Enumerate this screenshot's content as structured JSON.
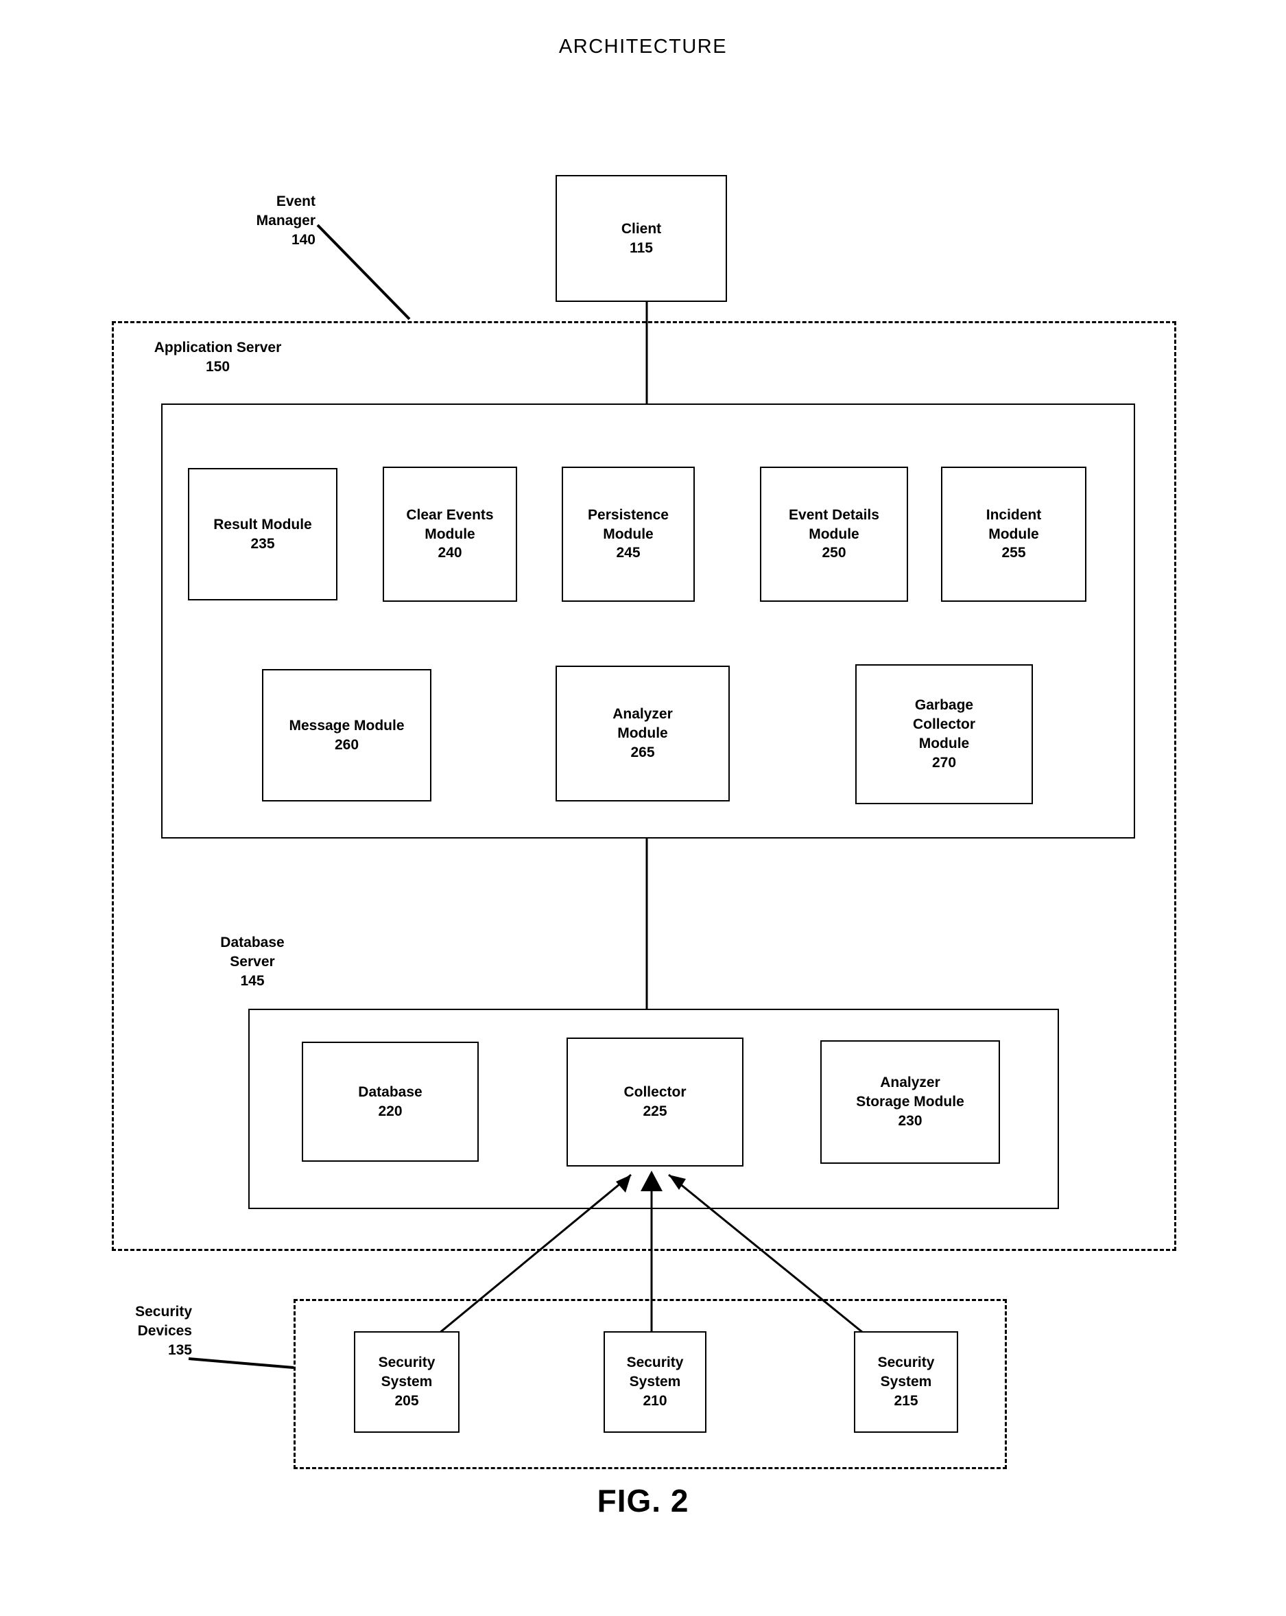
{
  "page": {
    "title": "ARCHITECTURE",
    "figure_caption": "FIG. 2"
  },
  "labels": {
    "event_manager": "Event\nManager\n140",
    "application_server": "Application Server\n150",
    "database_server": "Database\nServer\n145",
    "security_devices": "Security\nDevices\n135"
  },
  "nodes": {
    "client": {
      "title": "Client",
      "number": "115"
    },
    "result_module": {
      "title": "Result Module",
      "number": "235"
    },
    "clear_events": {
      "title": "Clear Events\nModule",
      "number": "240"
    },
    "persistence": {
      "title": "Persistence\nModule",
      "number": "245"
    },
    "event_details": {
      "title": "Event Details\nModule",
      "number": "250"
    },
    "incident": {
      "title": "Incident\nModule",
      "number": "255"
    },
    "message_module": {
      "title": "Message Module",
      "number": "260"
    },
    "analyzer_module": {
      "title": "Analyzer\nModule",
      "number": "265"
    },
    "garbage_collector": {
      "title": "Garbage\nCollector\nModule",
      "number": "270"
    },
    "database": {
      "title": "Database",
      "number": "220"
    },
    "collector": {
      "title": "Collector",
      "number": "225"
    },
    "analyzer_storage": {
      "title": "Analyzer\nStorage Module",
      "number": "230"
    },
    "security_system_205": {
      "title": "Security\nSystem",
      "number": "205"
    },
    "security_system_210": {
      "title": "Security\nSystem",
      "number": "210"
    },
    "security_system_215": {
      "title": "Security\nSystem",
      "number": "215"
    }
  },
  "colors": {
    "ink": "#000000",
    "paper": "#ffffff"
  }
}
